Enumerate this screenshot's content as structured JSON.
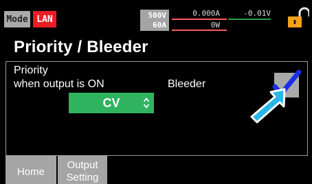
{
  "status": {
    "mode_label": "Mode",
    "interface_label": "LAN",
    "voltage_rating": "500V",
    "current_rating": "60A",
    "current_reading": "0.000A",
    "voltage_reading": "-0.01V",
    "power_reading": "0W",
    "colors": {
      "lan_bg": "#ec1c24",
      "lock": "#f5a21b",
      "current_underline": "#ff5a5a",
      "voltage_underline": "#2e9e4e"
    }
  },
  "page": {
    "title": "Priority / Bleeder"
  },
  "priority": {
    "label_line1": "Priority",
    "label_line2": "when output is ON",
    "selected_value": "CV",
    "color": "#2fb35f"
  },
  "bleeder": {
    "label": "Bleeder",
    "checked": true,
    "check_color": "#1a2ee8"
  },
  "cursor": {
    "icon": "pointer-arrow-icon",
    "color": "#29b6e6"
  },
  "tabs": [
    {
      "label": "Home"
    },
    {
      "label": "Output\nSetting"
    }
  ]
}
